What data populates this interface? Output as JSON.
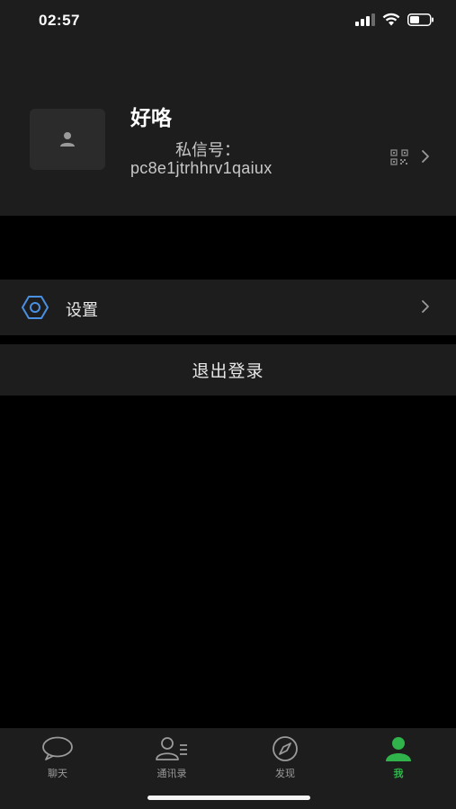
{
  "status_bar": {
    "time": "02:57"
  },
  "profile": {
    "nickname": "好咯",
    "chat_id_label": "私信号：",
    "chat_id_value": "pc8e1jtrhhrv1qaiux"
  },
  "menu": {
    "settings_label": "设置"
  },
  "logout": {
    "label": "退出登录"
  },
  "tabs": [
    {
      "label": "聊天",
      "icon": "chat-bubble-icon"
    },
    {
      "label": "通讯录",
      "icon": "contacts-icon"
    },
    {
      "label": "发现",
      "icon": "compass-icon"
    },
    {
      "label": "我",
      "icon": "person-icon"
    }
  ],
  "colors": {
    "accent_green": "#2fb34a",
    "settings_icon_blue": "#4a90e2",
    "panel_bg": "#1d1d1d",
    "page_bg": "#000000"
  }
}
